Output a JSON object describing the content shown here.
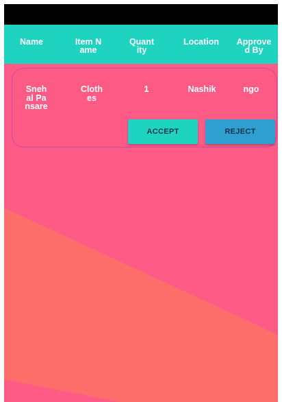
{
  "colors": {
    "header_bg": "#1fd3c1",
    "page_bg": "#fd5b86",
    "accent_band": "#fe6f6b",
    "accept_bg": "#1fd3c1",
    "reject_bg": "#2f9ed0",
    "card_border": "#c94aa2"
  },
  "table": {
    "headers": [
      "Name",
      "Item Name",
      "Quantity",
      "Location",
      "Approved By"
    ],
    "rows": [
      {
        "name": "Snehal Pansare",
        "item_name": "Clothes",
        "quantity": "1",
        "location": "Nashik",
        "approved_by": "ngo",
        "accept_label": "ACCEPT",
        "reject_label": "REJECT"
      }
    ]
  }
}
